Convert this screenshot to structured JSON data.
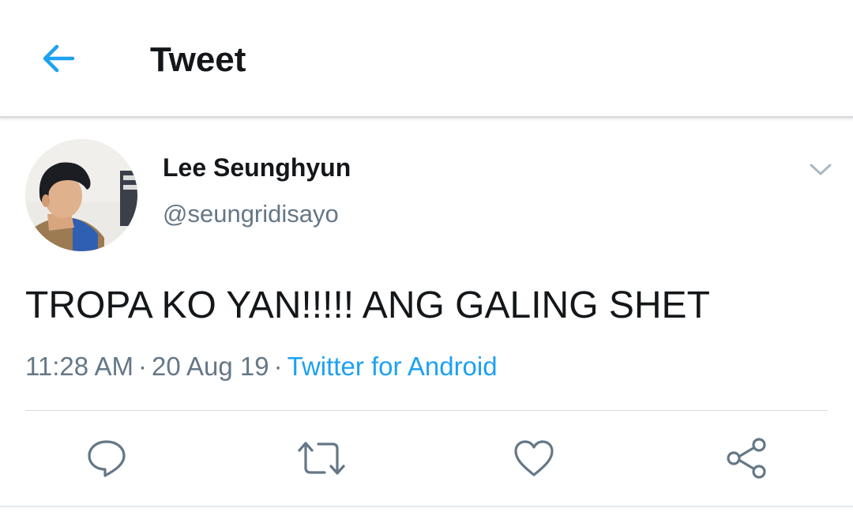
{
  "header": {
    "title": "Tweet",
    "back_icon": "arrow-left-icon"
  },
  "tweet": {
    "author": {
      "name": "Lee Seunghyun",
      "handle": "@seungridisayo"
    },
    "text": "TROPA KO YAN!!!!! ANG GALING SHET",
    "time": "11:28 AM",
    "separator": "·",
    "date": "20 Aug 19",
    "source": "Twitter for Android"
  },
  "actions": [
    "reply-icon",
    "retweet-icon",
    "like-icon",
    "share-icon"
  ],
  "colors": {
    "accent": "#1da1f2",
    "text_primary": "#14171a",
    "text_secondary": "#657786",
    "icon": "#657786"
  }
}
